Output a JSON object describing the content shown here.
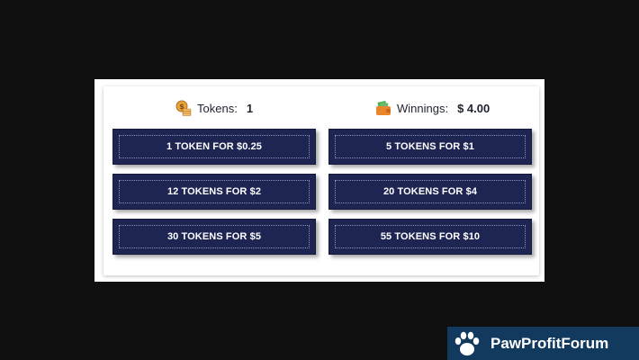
{
  "stats": {
    "tokens": {
      "label": "Tokens:",
      "value": "1",
      "icon": "coin-icon"
    },
    "winnings": {
      "label": "Winnings:",
      "value": "$ 4.00",
      "icon": "wallet-icon"
    }
  },
  "purchase_options": [
    {
      "label": "1 TOKEN FOR $0.25"
    },
    {
      "label": "5 TOKENS FOR $1"
    },
    {
      "label": "12 TOKENS FOR $2"
    },
    {
      "label": "20 TOKENS FOR $4"
    },
    {
      "label": "30 TOKENS FOR $5"
    },
    {
      "label": "55 TOKENS FOR $10"
    }
  ],
  "watermark": {
    "name": "PawProfitForum",
    "icon": "paw-icon"
  },
  "colors": {
    "button_bg": "#1e2553",
    "text_dark": "#1f2330",
    "watermark_bg": "#123a5e"
  }
}
